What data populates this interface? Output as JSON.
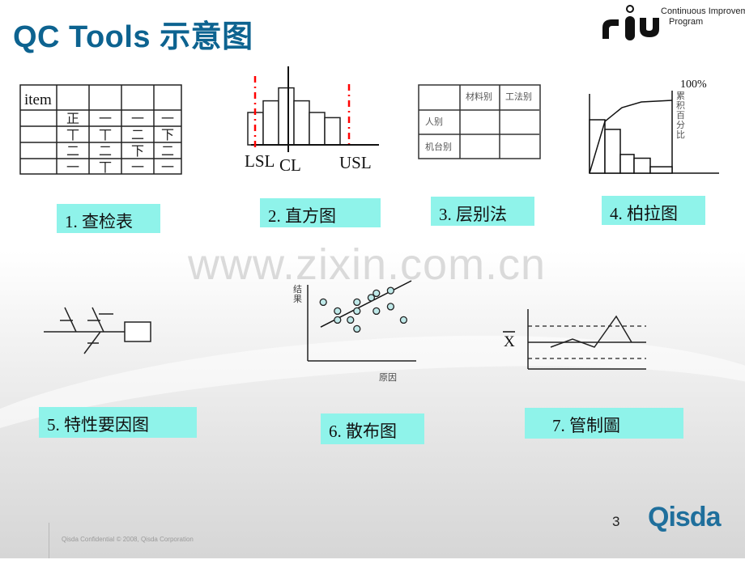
{
  "title": "QC Tools 示意图",
  "logo": {
    "letters": "cip",
    "line1": "Continuous Improvement",
    "line2": "Program"
  },
  "watermark": "www.zixin.com.cn",
  "tools": [
    {
      "label": "1. 查检表"
    },
    {
      "label": "2. 直方图"
    },
    {
      "label": "3. 层别法"
    },
    {
      "label": "4. 柏拉图"
    },
    {
      "label": "5. 特性要因图"
    },
    {
      "label": "6. 散布图"
    },
    {
      "label": "7. 管制圖"
    }
  ],
  "check_sheet": {
    "header": "item",
    "marks": [
      [
        "正",
        "一",
        "一",
        "一"
      ],
      [
        "丅",
        "丅",
        "二",
        "下"
      ],
      [
        "二",
        "二",
        "下",
        "二"
      ],
      [
        "一",
        "丅",
        "一",
        "一"
      ]
    ]
  },
  "histogram": {
    "labels": {
      "lsl": "LSL",
      "cl": "CL",
      "usl": "USL"
    },
    "bar_heights": [
      0.5,
      0.68,
      0.88,
      0.68,
      0.5,
      0.42
    ],
    "spec_color": "#ff0000"
  },
  "stratification": {
    "col_headers": [
      "材料别",
      "工法别"
    ],
    "row_headers": [
      "人别",
      "机台别"
    ]
  },
  "pareto": {
    "top_label": "100%",
    "axis_label": "累积百分比",
    "bar_values": [
      1.0,
      0.82,
      0.35,
      0.28,
      0.12
    ],
    "cumulative": [
      0,
      0.82,
      0.96,
      1.04,
      1.06
    ]
  },
  "scatter": {
    "ylabel": "结果",
    "xlabel": "原因",
    "point_fill": "#bfe9e9",
    "points": [
      [
        1.2,
        6.6
      ],
      [
        2.3,
        5.6
      ],
      [
        2.3,
        4.6
      ],
      [
        3.3,
        4.6
      ],
      [
        3.8,
        3.6
      ],
      [
        3.8,
        5.6
      ],
      [
        3.8,
        6.6
      ],
      [
        4.9,
        7.1
      ],
      [
        5.3,
        7.6
      ],
      [
        5.3,
        5.6
      ],
      [
        6.4,
        7.9
      ],
      [
        6.4,
        6.1
      ],
      [
        7.4,
        4.6
      ]
    ],
    "trend": [
      [
        1.0,
        3.8
      ],
      [
        8.0,
        9.0
      ]
    ]
  },
  "control_chart": {
    "ylabel": "X",
    "series": [
      0.35,
      0.6,
      0.35,
      1.3,
      0.5
    ],
    "ucl": 1.0,
    "cl": 0.5,
    "lcl": 0.0
  },
  "footer": {
    "confidential": "Qisda Confidential © 2008, Qisda Corporation",
    "page": "3",
    "brand": "Qisda"
  }
}
